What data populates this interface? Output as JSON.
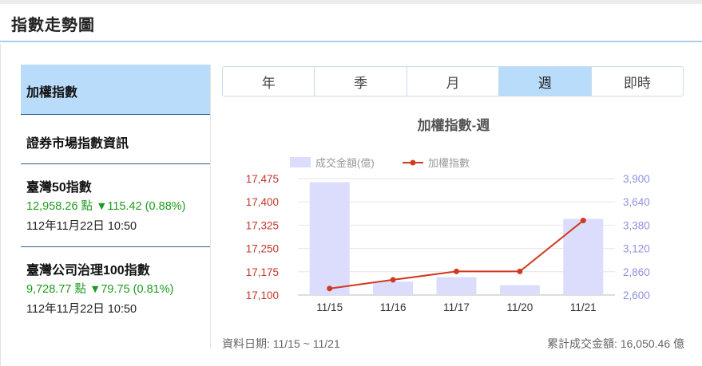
{
  "header": {
    "title": "指數走勢圖"
  },
  "sidebar": {
    "items": [
      {
        "label": "加權指數"
      },
      {
        "label": "證券市場指數資訊"
      },
      {
        "label": "臺灣50指數",
        "value": "12,958.26 點 ▼115.42 (0.88%)",
        "datetime": "112年11月22日 10:50"
      },
      {
        "label": "臺灣公司治理100指數",
        "value": "9,728.77 點 ▼79.75 (0.81%)",
        "datetime": "112年11月22日 10:50"
      }
    ]
  },
  "tabs": [
    {
      "label": "年"
    },
    {
      "label": "季"
    },
    {
      "label": "月"
    },
    {
      "label": "週",
      "active": true
    },
    {
      "label": "即時"
    }
  ],
  "footer": {
    "date_range": "資料日期: 11/15 ~ 11/21",
    "total_volume": "累計成交金額: 16,050.46 億"
  },
  "colors": {
    "accent": "#b8dcf9",
    "line": "#d03a1f",
    "bar": "#dcdcfc",
    "up_down": "#1f9a1f"
  },
  "chart_data": {
    "type": "bar",
    "title": "加權指數-週",
    "categories": [
      "11/15",
      "11/16",
      "11/17",
      "11/20",
      "11/21"
    ],
    "series": [
      {
        "name": "成交金額(億)",
        "type": "bar",
        "axis": "right",
        "values": [
          3860,
          2750,
          2800,
          2710,
          3450
        ]
      },
      {
        "name": "加權指數",
        "type": "line",
        "axis": "left",
        "values": [
          17121,
          17149,
          17176,
          17176,
          17340
        ]
      }
    ],
    "y_left": {
      "ticks": [
        "17,100",
        "17,175",
        "17,250",
        "17,325",
        "17,400",
        "17,475"
      ],
      "range": [
        17100,
        17475
      ]
    },
    "y_right": {
      "ticks": [
        "2,600",
        "2,860",
        "3,120",
        "3,380",
        "3,640",
        "3,900"
      ],
      "range": [
        2600,
        3900
      ]
    },
    "legend_position": "top-left",
    "grid": true
  }
}
